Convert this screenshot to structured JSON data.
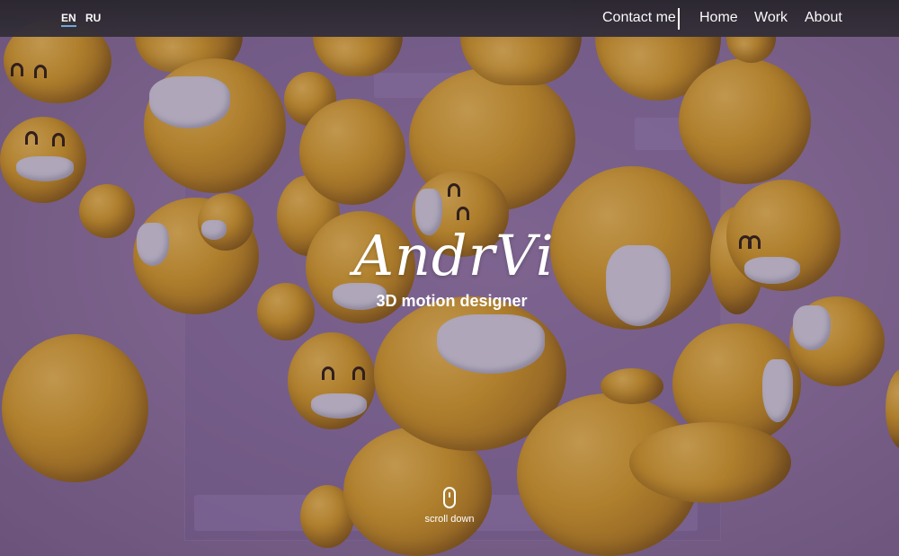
{
  "nav": {
    "languages": [
      "EN",
      "RU"
    ],
    "active_language": "EN",
    "contact_label": "Contact me",
    "links": [
      "Home",
      "Work",
      "About"
    ]
  },
  "hero": {
    "title": "AndrVi",
    "subtitle": "3D motion designer",
    "background_subject": "falling smiling emoji balls wearing face masks"
  },
  "scroll": {
    "label": "scroll down",
    "icon": "mouse-icon"
  },
  "colors": {
    "nav_bg": "#2e2a33",
    "active_underline": "#6fa9e6",
    "emoji_yellow": "#d9a21c",
    "overlay": "#6a4a7a"
  }
}
